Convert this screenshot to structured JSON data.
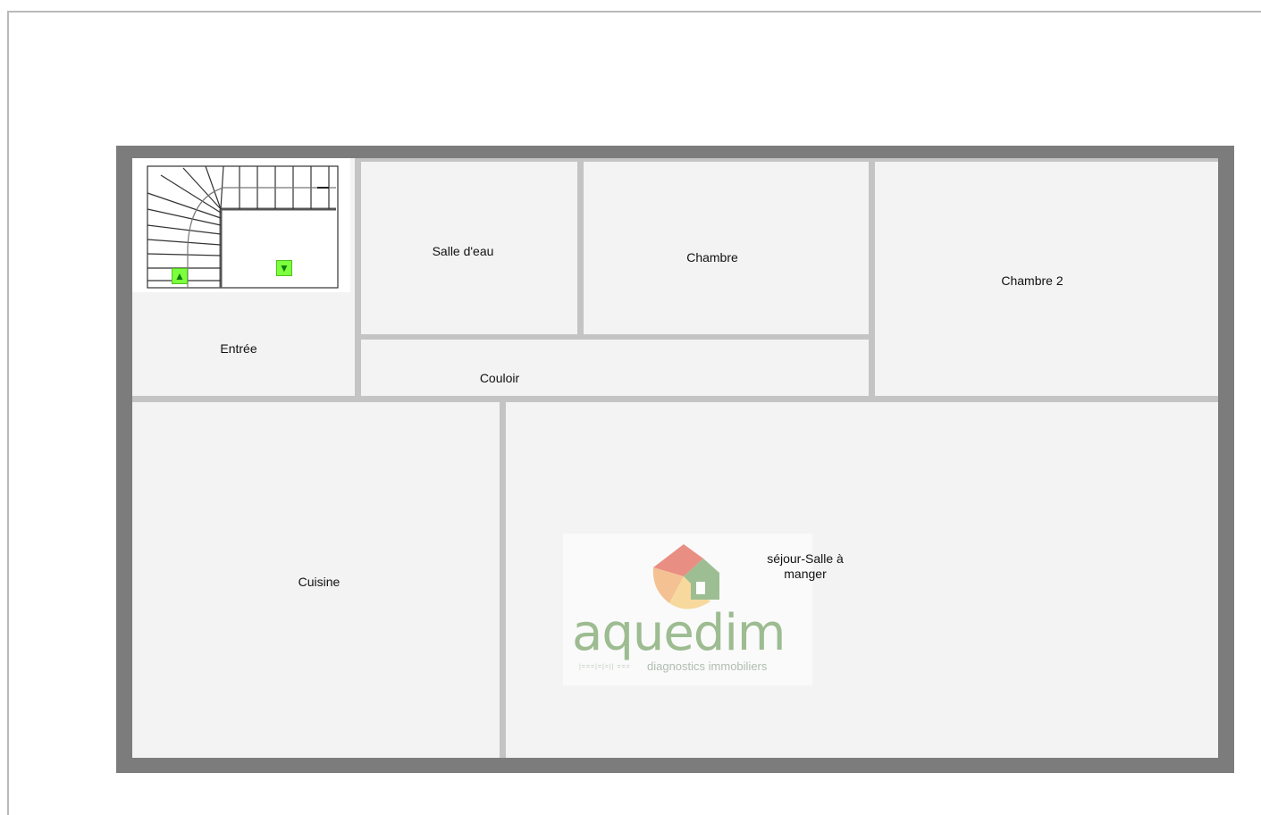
{
  "plan": {
    "rooms": {
      "entree": "Entrée",
      "salle_eau": "Salle d'eau",
      "chambre": "Chambre",
      "chambre2": "Chambre 2",
      "couloir": "Couloir",
      "cuisine": "Cuisine",
      "sejour": "séjour-Salle à manger"
    },
    "colors": {
      "outer_wall": "#7c7c7c",
      "inner_wall": "#c4c4c4",
      "room_fill": "#f3f3f3",
      "stair_arrow": "#7cff3c"
    },
    "icons": [
      "staircase-icon",
      "arrow-up-icon",
      "arrow-down-icon"
    ]
  },
  "watermark": {
    "brand": "aquedim",
    "tagline": "diagnostics immobiliers",
    "icon": "house-logo-icon"
  }
}
